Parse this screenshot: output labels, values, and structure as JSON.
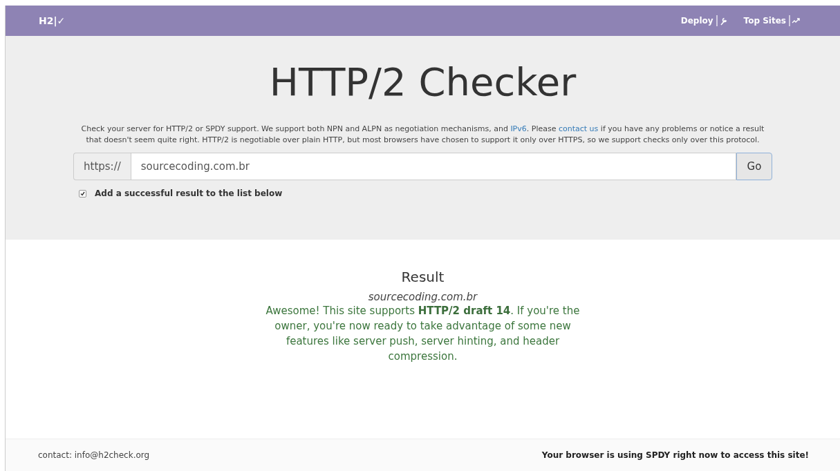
{
  "navbar": {
    "brand": "H2|✓",
    "links": [
      {
        "label": "Deploy",
        "kind": "tools"
      },
      {
        "label": "Top Sites",
        "kind": "ranking"
      }
    ]
  },
  "hero": {
    "title": "HTTP/2 Checker",
    "intro": [
      {
        "kind": "text",
        "text": "Check your server for HTTP/2 or SPDY support. We support both NPN and ALPN as negotiation mechanisms, and "
      },
      {
        "kind": "link",
        "text": "IPv6"
      },
      {
        "kind": "text",
        "text": ". Please "
      },
      {
        "kind": "link",
        "text": "contact us"
      },
      {
        "kind": "text",
        "text": " if you have any problems or notice a result that doesn't seem quite right. HTTP/2 is negotiable over plain HTTP, but most browsers have chosen to support it only over HTTPS, so we support checks only over this protocol."
      }
    ],
    "prefix": "https://",
    "url": "sourcecoding.com.br",
    "button": "Go",
    "checkbox": {
      "label": "Add a successful result to the list below",
      "checked": true
    }
  },
  "result": {
    "heading": "Result",
    "site": "sourcecoding.com.br",
    "message": "Awesome! This site supports **HTTP/2 draft 14**. If you're the owner, you're now ready to take advantage of some new features like server push, server hinting, and header compression."
  },
  "footer": {
    "contact": "contact: info@h2check.org",
    "notice": "Your browser is using SPDY right now to access this site!"
  }
}
